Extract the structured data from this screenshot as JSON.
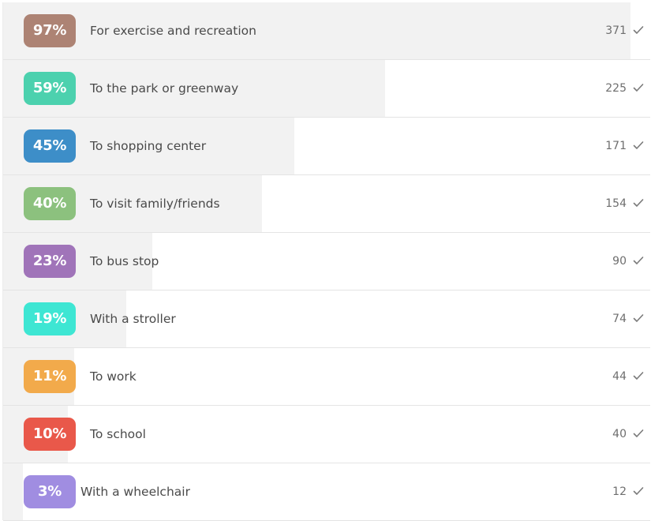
{
  "chart_data": {
    "type": "bar",
    "orientation": "horizontal",
    "categories": [
      "For exercise and recreation",
      "To the park or greenway",
      "To shopping center",
      "To visit family/friends",
      "To bus stop",
      "With a stroller",
      "To work",
      "To school",
      "With a wheelchair"
    ],
    "percent_labels": [
      "97%",
      "59%",
      "45%",
      "40%",
      "23%",
      "19%",
      "11%",
      "10%",
      "3%"
    ],
    "percent_values": [
      97,
      59,
      45,
      40,
      23,
      19,
      11,
      10,
      3
    ],
    "values": [
      371,
      225,
      171,
      154,
      90,
      74,
      44,
      40,
      12
    ],
    "count_labels": [
      "371",
      "225",
      "171",
      "154",
      "90",
      "74",
      "44",
      "40",
      "12"
    ],
    "badge_colors": [
      "#ad8374",
      "#4cd1ae",
      "#3d8ec8",
      "#8cc17e",
      "#a074b9",
      "#3ee6d3",
      "#f2aa4b",
      "#e9584a",
      "#a08de1"
    ],
    "bar_color": "#f2f2f2",
    "count_icon": "check-icon",
    "xlim": [
      0,
      100
    ],
    "grid": false
  }
}
